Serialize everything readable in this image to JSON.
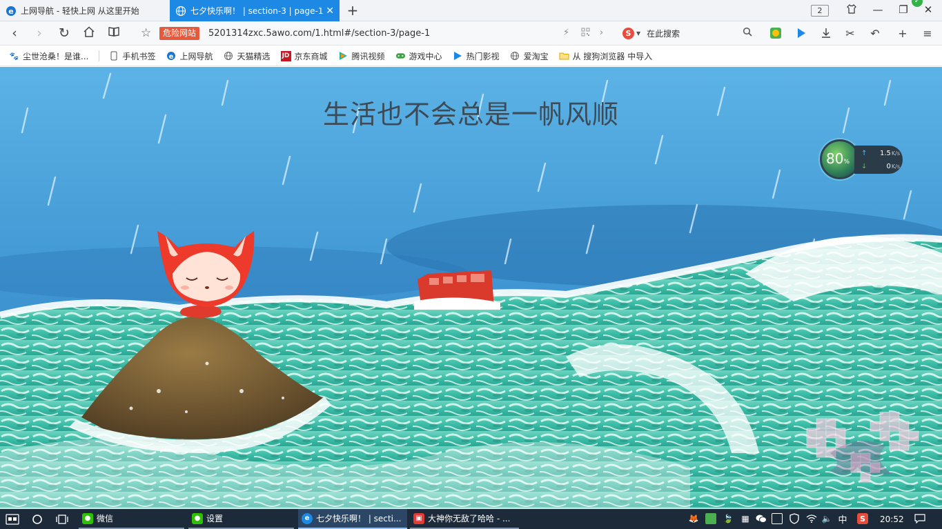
{
  "tabs": [
    {
      "title": "上网导航 - 轻快上网 从这里开始",
      "active": false
    },
    {
      "title": "七夕快乐啊！ | section-3 | page-1",
      "active": true
    }
  ],
  "tab_count": "2",
  "toolbar": {
    "danger_label": "危险网站",
    "url": "5201314zxc.5awo.com/1.html#/section-3/page-1",
    "search_placeholder": "在此搜索"
  },
  "bookmarks": [
    {
      "label": "尘世沧桑！是谁...",
      "icon": "cat-icon"
    },
    {
      "label": "手机书签",
      "icon": "phone-icon"
    },
    {
      "label": "上网导航",
      "icon": "ie-icon"
    },
    {
      "label": "天猫精选",
      "icon": "globe-icon"
    },
    {
      "label": "京东商城",
      "icon": "jd-icon"
    },
    {
      "label": "腾讯视频",
      "icon": "video-icon"
    },
    {
      "label": "游戏中心",
      "icon": "gamepad-icon"
    },
    {
      "label": "热门影视",
      "icon": "play-icon"
    },
    {
      "label": "爱淘宝",
      "icon": "globe-icon"
    },
    {
      "label": "从 搜狗浏览器 中导入",
      "icon": "folder-icon"
    }
  ],
  "page": {
    "heading": "生活也不会总是一帆风顺"
  },
  "speed_widget": {
    "percent": "80",
    "percent_sign": "%",
    "upload": "1.5",
    "upload_unit": "K/s",
    "download": "0",
    "download_unit": "K/s"
  },
  "taskbar": {
    "apps": [
      {
        "label": "微信",
        "active": false
      },
      {
        "label": "设置",
        "active": false
      },
      {
        "label": "七夕快乐啊！ | secti...",
        "active": true
      },
      {
        "label": "大神你无敌了哈哈 - ...",
        "active": false
      }
    ],
    "ime": "中",
    "clock": "20:52"
  },
  "colors": {
    "tab_active": "#1e88e5",
    "danger": "#e55a3c",
    "taskbar": "#1c2a3a",
    "sky": "#4aa3dc",
    "sea": "#3fbfa9"
  }
}
